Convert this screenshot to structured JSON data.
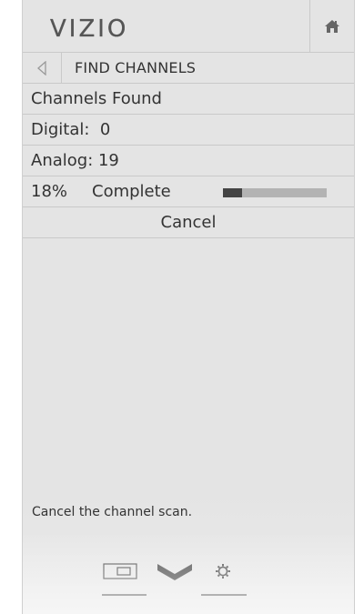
{
  "header": {
    "logo_text": "VIZIO",
    "home_icon": "home-icon"
  },
  "nav": {
    "back_icon": "back-arrow-icon",
    "title": "FIND CHANNELS"
  },
  "rows": {
    "channels_found": "Channels Found",
    "digital": "Digital:  0",
    "analog": "Analog: 19"
  },
  "progress": {
    "percent_label": "18%",
    "status_label": "Complete",
    "fraction": 0.18
  },
  "cancel_label": "Cancel",
  "help_text": "Cancel the channel scan.",
  "bottom_bar": {
    "icons": [
      "input-source-icon",
      "vizio-v-icon",
      "settings-gear-icon"
    ]
  },
  "colors": {
    "panel_bg": "#e4e4e4",
    "divider": "#c9c9c9",
    "text": "#333333",
    "progress_track": "#b3b3b3",
    "progress_fill": "#444444"
  }
}
